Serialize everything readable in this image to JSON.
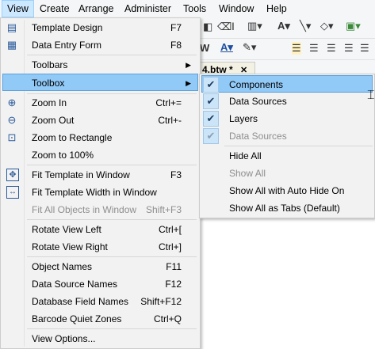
{
  "menubar": {
    "items": [
      {
        "label": "View"
      },
      {
        "label": "Create"
      },
      {
        "label": "Arrange"
      },
      {
        "label": "Administer"
      },
      {
        "label": "Tools"
      },
      {
        "label": "Window"
      },
      {
        "label": "Help"
      }
    ]
  },
  "document_tab": {
    "label": "4.btw *",
    "close": "✕"
  },
  "view_menu": {
    "items": [
      {
        "label": "Template Design",
        "shortcut": "F7",
        "icon": "template-design-icon"
      },
      {
        "label": "Data Entry Form",
        "shortcut": "F8",
        "icon": "data-entry-form-icon"
      },
      {
        "label": "Toolbars",
        "submenu": true
      },
      {
        "label": "Toolbox",
        "submenu": true
      },
      {
        "label": "Zoom In",
        "shortcut": "Ctrl+=",
        "icon": "zoom-in-icon"
      },
      {
        "label": "Zoom Out",
        "shortcut": "Ctrl+-",
        "icon": "zoom-out-icon"
      },
      {
        "label": "Zoom to Rectangle",
        "icon": "zoom-rectangle-icon"
      },
      {
        "label": "Zoom to 100%"
      },
      {
        "label": "Fit Template in Window",
        "shortcut": "F3",
        "icon": "fit-template-icon"
      },
      {
        "label": "Fit Template Width in Window",
        "icon": "fit-width-icon"
      },
      {
        "label": "Fit All Objects in Window",
        "shortcut": "Shift+F3",
        "disabled": true
      },
      {
        "label": "Rotate View Left",
        "shortcut": "Ctrl+["
      },
      {
        "label": "Rotate View Right",
        "shortcut": "Ctrl+]"
      },
      {
        "label": "Object Names",
        "shortcut": "F11"
      },
      {
        "label": "Data Source Names",
        "shortcut": "F12"
      },
      {
        "label": "Database Field Names",
        "shortcut": "Shift+F12"
      },
      {
        "label": "Barcode Quiet Zones",
        "shortcut": "Ctrl+Q"
      },
      {
        "label": "View Options..."
      }
    ]
  },
  "toolbox_submenu": {
    "items": [
      {
        "label": "Components",
        "checked": true
      },
      {
        "label": "Data Sources",
        "checked": true
      },
      {
        "label": "Layers",
        "checked": true
      },
      {
        "label": "Data Sources",
        "checked": true,
        "disabled": true
      },
      {
        "label": "Hide All"
      },
      {
        "label": "Show All",
        "disabled": true
      },
      {
        "label": "Show All with Auto Hide On"
      },
      {
        "label": "Show All as Tabs (Default)"
      }
    ]
  },
  "colors": {
    "highlight": "#91c9f7",
    "menu_bg": "#f2f2f2",
    "disabled_text": "#8e8e8e"
  }
}
